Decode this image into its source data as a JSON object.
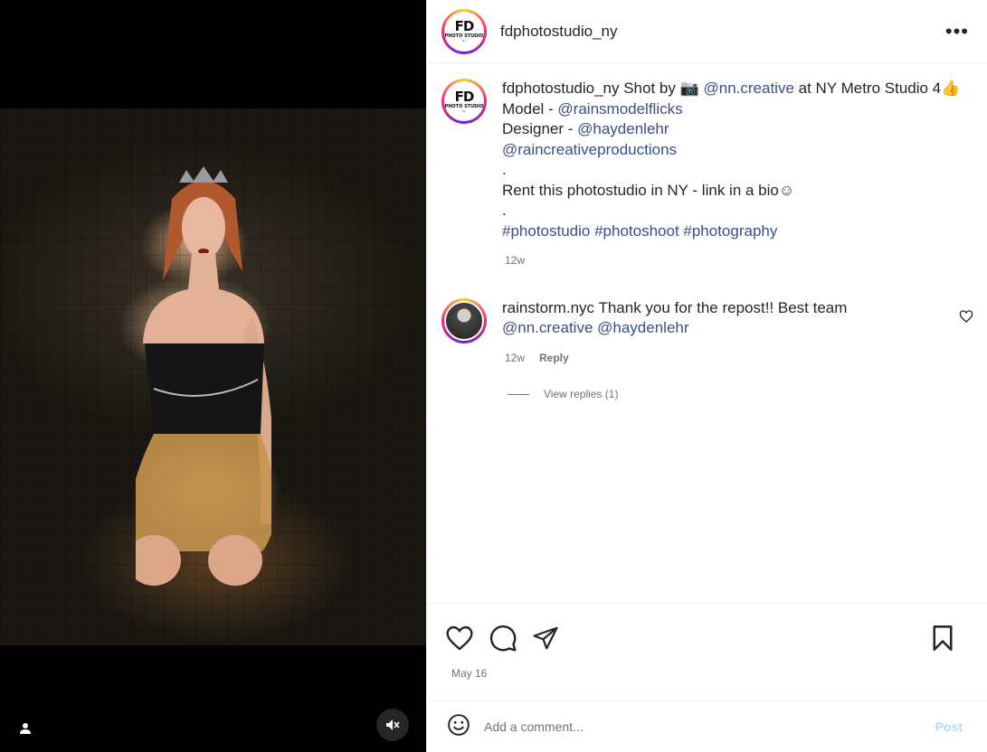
{
  "media": {
    "user_tag_icon": "person-icon",
    "mute_icon": "speaker-muted-icon"
  },
  "header": {
    "username": "fdphotostudio_ny",
    "avatar_logo": {
      "big": "FD",
      "small": "PHOTO STUDIO",
      "tiny": "NY"
    },
    "more_icon": "more-horizontal-icon",
    "more_label": "•••"
  },
  "caption": {
    "username": "fdphotostudio_ny",
    "line1_text": " Shot by 📷 ",
    "line1_mention": "@nn.creative",
    "line1_tail": " at NY Metro Studio 4👍",
    "model_label": "Model - ",
    "model_mention": "@rainsmodelflicks",
    "designer_label": "Designer - ",
    "designer_mention": "@haydenlehr",
    "production_mention": "@raincreativeproductions",
    "dot1": ".",
    "rent_text": "Rent this photostudio in NY - link in a bio☺",
    "dot2": ".",
    "hashtags": "#photostudio #photoshoot #photography",
    "time": "12w"
  },
  "comment": {
    "username": "rainstorm.nyc",
    "text": " Thank you for the repost!! Best team",
    "mentions": "@nn.creative @haydenlehr",
    "time": "12w",
    "reply_label": "Reply",
    "view_replies": "View replies (1)"
  },
  "actions": {
    "date": "May 16"
  },
  "add_comment": {
    "placeholder": "Add a comment...",
    "post_label": "Post"
  },
  "colors": {
    "link": "#385185",
    "muted": "#737373",
    "post_disabled": "#b3dbff"
  }
}
